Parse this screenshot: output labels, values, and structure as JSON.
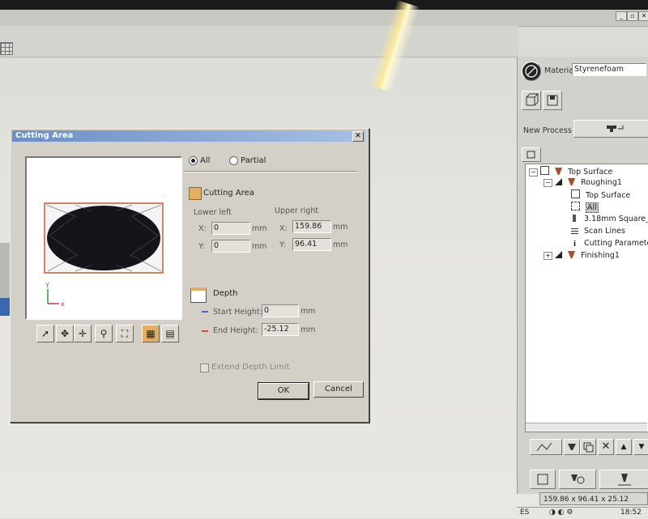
{
  "dialog": {
    "title": "Cutting Area",
    "close_glyph": "✕",
    "radio_all": "All",
    "radio_partial": "Partial",
    "section_cutting_area": "Cutting Area",
    "lower_left": "Lower left",
    "upper_right": "Upper right",
    "x_label": "X:",
    "y_label": "Y:",
    "unit": "mm",
    "lower_left_x": "0",
    "lower_left_y": "0",
    "upper_right_x": "159.86",
    "upper_right_y": "96.41",
    "section_depth": "Depth",
    "start_height_label": "Start Height:",
    "start_height": "0",
    "end_height_label": "End Height:",
    "end_height": "-25.12",
    "extend_depth_limit": "Extend Depth Limit",
    "ok": "OK",
    "cancel": "Cancel",
    "axis_y": "Y",
    "axis_x": "x"
  },
  "panel": {
    "material_label": "Material",
    "material_value": "Styrenefoam",
    "new_process_label": "New Process",
    "tree": [
      {
        "label": "Top Surface",
        "indent": 0,
        "expander": "−"
      },
      {
        "label": "Roughing1",
        "indent": 1,
        "expander": "−"
      },
      {
        "label": "Top Surface",
        "indent": 2,
        "expander": ""
      },
      {
        "label": "All",
        "indent": 2,
        "expander": ""
      },
      {
        "label": "3.18mm Square_styr",
        "indent": 2,
        "expander": ""
      },
      {
        "label": "Scan Lines",
        "indent": 2,
        "expander": ""
      },
      {
        "label": "Cutting Parameters",
        "indent": 2,
        "expander": ""
      },
      {
        "label": "Finishing1",
        "indent": 1,
        "expander": "+"
      }
    ]
  },
  "status": {
    "dimensions": "159.86 x 96.41 x 25.12 [mm]",
    "lang": "ES",
    "time": "18:52"
  },
  "colors": {
    "dialog_bg": "#d4d0c8",
    "title_gradient_start": "#6b8fc4",
    "area_icon": "#e0b060",
    "start_line": "#3a6bc9",
    "end_line": "#c9503a"
  }
}
